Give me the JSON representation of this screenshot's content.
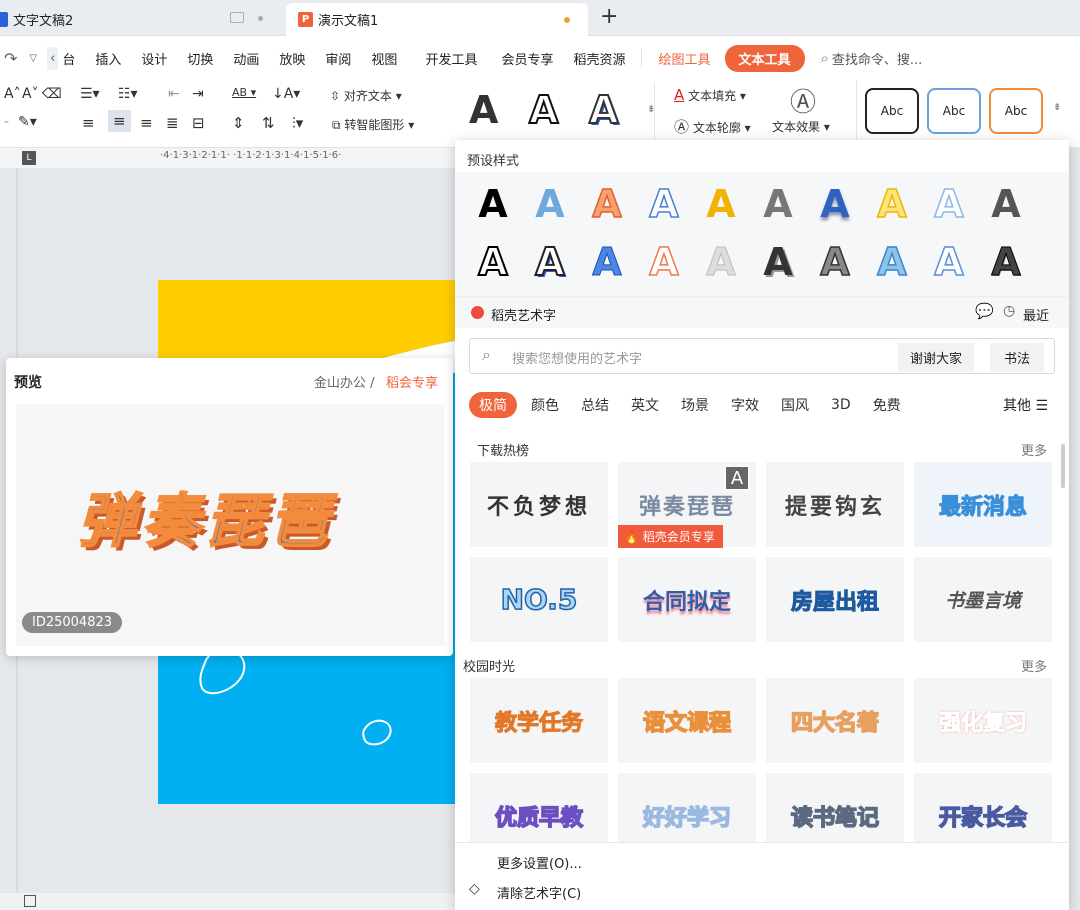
{
  "tabs": {
    "doc": {
      "icon": "W",
      "title": "文字文稿2"
    },
    "ppt": {
      "icon": "P",
      "title": "演示文稿1"
    },
    "new_tab": "+"
  },
  "menu": {
    "items": [
      "台",
      "插入",
      "设计",
      "切换",
      "动画",
      "放映",
      "审阅",
      "视图",
      "开发工具",
      "会员专享",
      "稻壳资源"
    ],
    "drawing_tools": "绘图工具",
    "text_tools": "文本工具",
    "search": "查找命令、搜..."
  },
  "toolbar": {
    "align_text": "对齐文本",
    "smart_shape": "转智能图形",
    "text_fill": "文本填充",
    "text_outline": "文本轮廓",
    "text_effect": "文本效果",
    "big_a": "A",
    "abc": "Abc",
    "accent": "#f0643c"
  },
  "ruler": {
    "marks": "·4·1·3·1·2·1·1·  ·1·1·2·1·3·1·4·1·5·1·6·"
  },
  "preview": {
    "title": "预览",
    "source": "金山办公 / ",
    "member": "稻会专享",
    "art_text": "弹奏琵琶",
    "id": "ID25004823"
  },
  "gallery": {
    "preset_title": "预设样式",
    "presets_row1": [
      "A",
      "A",
      "A",
      "A",
      "A",
      "A",
      "A",
      "A",
      "A",
      "A"
    ],
    "presets_row2": [
      "A",
      "A",
      "A",
      "A",
      "A",
      "A",
      "A",
      "A",
      "A",
      "A"
    ],
    "brand": "稻壳艺术字",
    "recent": "最近",
    "search_placeholder": "搜索您想使用的艺术字",
    "tag1": "谢谢大家",
    "tag2": "书法",
    "categories": [
      "极简",
      "颜色",
      "总结",
      "英文",
      "场景",
      "字效",
      "国风",
      "3D",
      "免费"
    ],
    "other": "其他",
    "section1": {
      "title": "下载热榜",
      "more": "更多",
      "tiles": [
        "不负梦想",
        "弹奏琵琶",
        "提要钩玄",
        "最新消息",
        "NO.5",
        "合同拟定",
        "房屋出租",
        "书墨言境"
      ]
    },
    "member_badge": "稻壳会员专享",
    "section2": {
      "title": "校园时光",
      "more": "更多",
      "tiles": [
        "教学任务",
        "语文课程",
        "四大名著",
        "强化复习",
        "优质早教",
        "好好学习",
        "读书笔记",
        "开家长会"
      ]
    },
    "more_settings": "更多设置(O)...",
    "clear": "清除艺术字(C)"
  }
}
